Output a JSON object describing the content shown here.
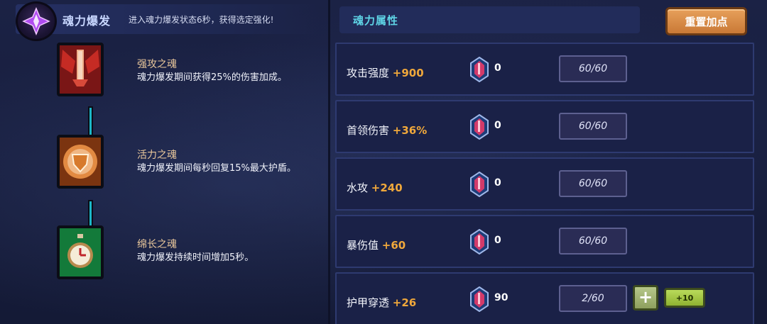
{
  "left_panel": {
    "title": "魂力爆发",
    "description": "进入魂力爆发状态6秒，获得选定强化!",
    "souls": [
      {
        "name": "强攻之魂",
        "desc": "魂力爆发期间获得25%的伤害加成。",
        "icon": "winged-sword-icon"
      },
      {
        "name": "活力之魂",
        "desc": "魂力爆发期间每秒回复15%最大护盾。",
        "icon": "shield-emblem-icon"
      },
      {
        "name": "绵长之魂",
        "desc": "魂力爆发持续时间增加5秒。",
        "icon": "stopwatch-icon"
      }
    ]
  },
  "right_panel": {
    "title": "魂力属性",
    "reset_label": "重置加点",
    "attributes": [
      {
        "label": "攻击强度",
        "bonus": "+900",
        "gems": "0",
        "level": "60/60"
      },
      {
        "label": "首领伤害",
        "bonus": "+36%",
        "gems": "0",
        "level": "60/60"
      },
      {
        "label": "水攻",
        "bonus": "+240",
        "gems": "0",
        "level": "60/60"
      },
      {
        "label": "暴伤值",
        "bonus": "+60",
        "gems": "0",
        "level": "60/60"
      },
      {
        "label": "护甲穿透",
        "bonus": "+26",
        "gems": "90",
        "level": "2/60",
        "plus_label": "+",
        "plus10_label": "+10"
      }
    ]
  },
  "colors": {
    "accent_cyan": "#5fd5e6",
    "bonus_orange": "#f0a83b",
    "reset_button": "#d98a45",
    "plus_button": "#a3b574"
  }
}
